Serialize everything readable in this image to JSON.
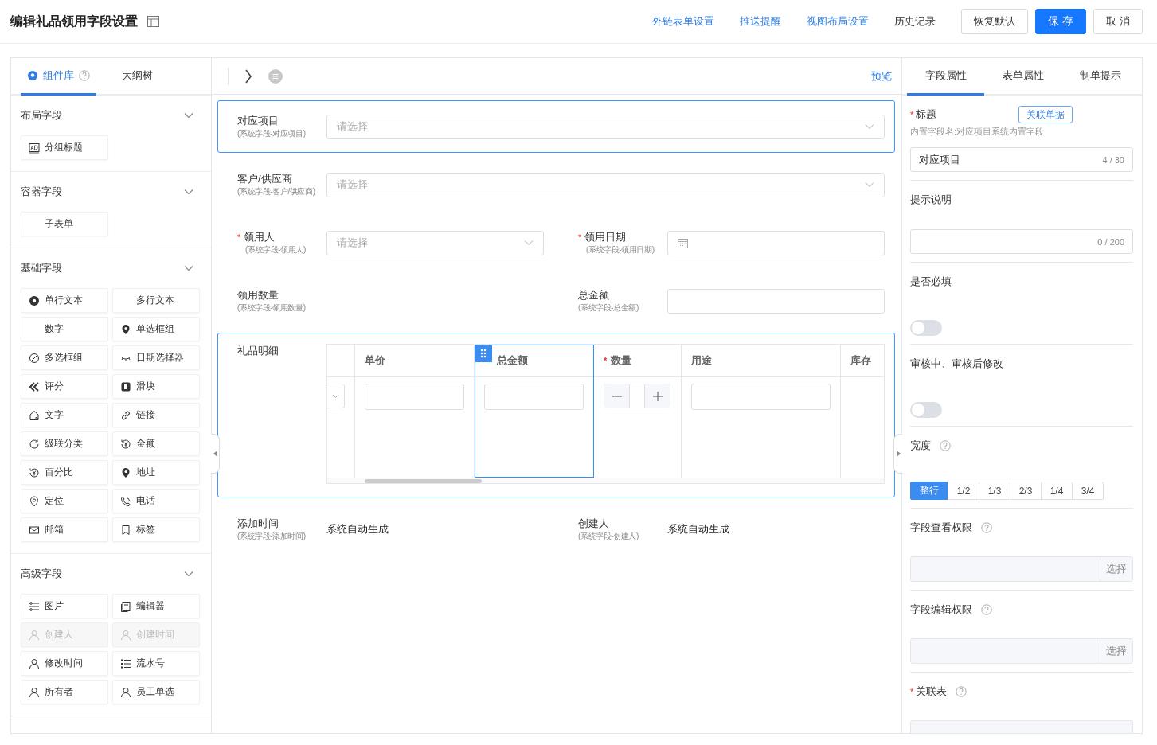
{
  "header": {
    "title": "编辑礼品领用字段设置",
    "links": [
      "外链表单设置",
      "推送提醒",
      "视图布局设置"
    ],
    "history": "历史记录",
    "buttons": [
      {
        "label": "恢复默认",
        "primary": false
      },
      {
        "label": "保 存",
        "primary": true
      },
      {
        "label": "取 消",
        "primary": false
      }
    ]
  },
  "left_panel": {
    "tabs": [
      {
        "label": "组件库",
        "selected": true
      },
      {
        "label": "大纲树",
        "selected": false
      }
    ],
    "sections": [
      {
        "title": "布局字段",
        "expanded": true,
        "items": [
          {
            "label": "分组标题",
            "disabled": false
          }
        ]
      },
      {
        "title": "容器字段",
        "expanded": true,
        "items": [
          {
            "label": "子表单",
            "disabled": false
          }
        ]
      },
      {
        "title": "基础字段",
        "expanded": true,
        "items": [
          {
            "label": "单行文本",
            "disabled": false
          },
          {
            "label": "多行文本",
            "disabled": false
          },
          {
            "label": "数字",
            "disabled": false
          },
          {
            "label": "单选框组",
            "disabled": false
          },
          {
            "label": "多选框组",
            "disabled": false
          },
          {
            "label": "日期选择器",
            "disabled": false
          },
          {
            "label": "评分",
            "disabled": false
          },
          {
            "label": "滑块",
            "disabled": false
          },
          {
            "label": "文字",
            "disabled": false
          },
          {
            "label": "链接",
            "disabled": false
          },
          {
            "label": "级联分类",
            "disabled": false
          },
          {
            "label": "金额",
            "disabled": false
          },
          {
            "label": "百分比",
            "disabled": false
          },
          {
            "label": "地址",
            "disabled": false
          },
          {
            "label": "定位",
            "disabled": false
          },
          {
            "label": "电话",
            "disabled": false
          },
          {
            "label": "邮箱",
            "disabled": false
          },
          {
            "label": "标签",
            "disabled": false
          }
        ]
      },
      {
        "title": "高级字段",
        "expanded": true,
        "items": [
          {
            "label": "图片",
            "disabled": false
          },
          {
            "label": "编辑器",
            "disabled": false
          },
          {
            "label": "创建人",
            "disabled": true
          },
          {
            "label": "创建时间",
            "disabled": true
          },
          {
            "label": "修改时间",
            "disabled": false
          },
          {
            "label": "流水号",
            "disabled": false
          },
          {
            "label": "所有者",
            "disabled": false
          },
          {
            "label": "员工单选",
            "disabled": false
          }
        ]
      }
    ]
  },
  "canvas": {
    "preview": "预览",
    "rows": [
      {
        "selected": true,
        "fields": [
          {
            "kind": "select",
            "label": "对应项目",
            "sublabel": "(系统字段-对应项目)",
            "placeholder": "请选择"
          }
        ]
      },
      {
        "selected": false,
        "fields": [
          {
            "kind": "select",
            "label": "客户/供应商",
            "sublabel": "(系统字段-客户/供应商)",
            "placeholder": "请选择"
          }
        ]
      },
      {
        "selected": false,
        "fields": [
          {
            "kind": "select",
            "label": "领用人",
            "sublabel": "(系统字段-领用人)",
            "required_mark": "*",
            "placeholder": "请选择"
          },
          {
            "kind": "date",
            "label": "领用日期",
            "sublabel": "(系统字段-领用日期)",
            "required_mark": "*"
          }
        ]
      },
      {
        "selected": false,
        "fields": [
          {
            "kind": "blank",
            "label": "领用数量",
            "sublabel": "(系统字段-领用数量)"
          },
          {
            "kind": "input",
            "label": "总金额",
            "sublabel": "(系统字段-总金额)"
          }
        ]
      },
      {
        "selected": true,
        "fields": [
          {
            "kind": "subtable",
            "label": "礼品明细",
            "columns": [
              {
                "kind": "select",
                "selected": false
              },
              {
                "kind": "input",
                "label": "单价",
                "selected": false
              },
              {
                "kind": "input",
                "label": "总金额",
                "selected": true
              },
              {
                "kind": "stepper",
                "label": "数量",
                "selected": false,
                "required_mark": "*"
              },
              {
                "kind": "input",
                "label": "用途",
                "selected": false
              },
              {
                "kind": "blank",
                "label": "库存",
                "selected": false
              }
            ]
          }
        ]
      },
      {
        "selected": false,
        "fields": [
          {
            "kind": "static",
            "label": "添加时间",
            "sublabel": "(系统字段-添加时间)",
            "value": "系统自动生成"
          },
          {
            "kind": "static",
            "label": "创建人",
            "sublabel": "(系统字段-创建人)",
            "value": "系统自动生成"
          }
        ]
      }
    ]
  },
  "properties": {
    "tabs": [
      {
        "label": "字段属性",
        "selected": true
      },
      {
        "label": "表单属性",
        "selected": false
      },
      {
        "label": "制单提示",
        "selected": false
      }
    ],
    "sections": [
      {
        "kind": "text",
        "label": "标题",
        "required_mark": "*",
        "help": false,
        "action": "关联单据",
        "hint": "内置字段名:对应项目系统内置字段",
        "value": "对应项目",
        "counter": "4 / 30"
      },
      {
        "kind": "text",
        "label": "提示说明",
        "help": false,
        "counter": "0 / 200"
      },
      {
        "kind": "toggle",
        "label": "是否必填",
        "help": false,
        "on": false
      },
      {
        "kind": "toggle",
        "label": "审核中、审核后修改",
        "help": false,
        "on": false
      },
      {
        "kind": "segmented",
        "label": "宽度",
        "help": true,
        "options": [
          {
            "label": "整行",
            "selected": true
          },
          {
            "label": "1/2",
            "selected": false
          },
          {
            "label": "1/3",
            "selected": false
          },
          {
            "label": "2/3",
            "selected": false
          },
          {
            "label": "1/4",
            "selected": false
          },
          {
            "label": "3/4",
            "selected": false
          }
        ]
      },
      {
        "kind": "picker",
        "label": "字段查看权限",
        "help": true,
        "button": "选择"
      },
      {
        "kind": "picker",
        "label": "字段编辑权限",
        "help": true,
        "button": "选择"
      },
      {
        "kind": "picker",
        "label": "关联表",
        "required_mark": "*",
        "help": true
      }
    ]
  }
}
